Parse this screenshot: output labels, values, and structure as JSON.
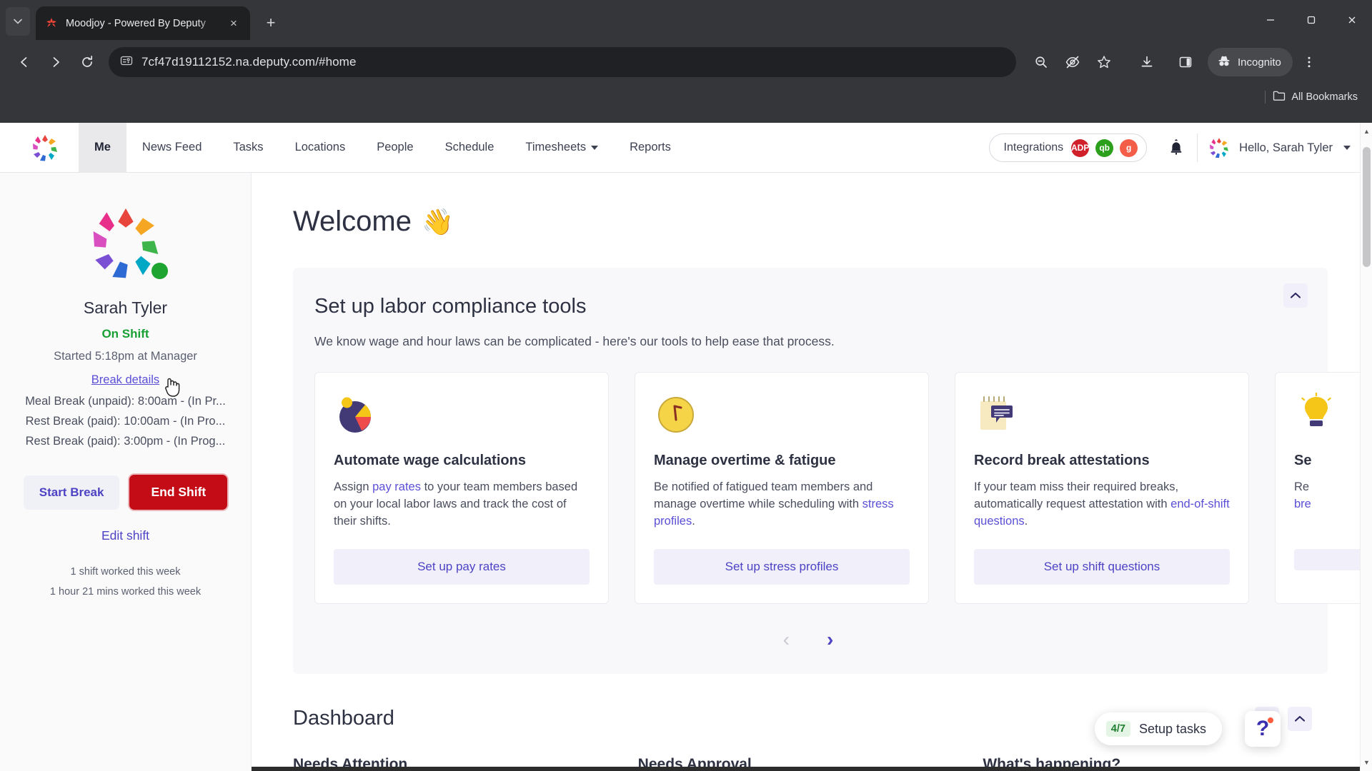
{
  "browser": {
    "tab": {
      "title": "Moodjoy - Powered By Deputy",
      "favicon_name": "moodjoy-favicon"
    },
    "new_tab_label": "+",
    "tab_list_label": "⌄",
    "close_tab_label": "×",
    "window": {
      "minimize": "—",
      "maximize": "❐",
      "close": "✕"
    },
    "toolbar": {
      "back": "←",
      "forward": "→",
      "reload": "⟳",
      "url": "7cf47d19112152.na.deputy.com/#home",
      "site_info_name": "site-info-icon",
      "zoom_out_icon": "zoom-out-icon",
      "hide_icon": "hide-password-icon",
      "bookmark_icon": "star-icon",
      "download_icon": "download-icon",
      "sidepanel_icon": "side-panel-icon",
      "incognito_label": "Incognito",
      "menu_icon": "three-dot-menu-icon"
    },
    "bookmarks": {
      "label": "All Bookmarks"
    }
  },
  "app": {
    "nav": {
      "logo_name": "deputy-logo",
      "items": [
        {
          "label": "Me",
          "active": true,
          "dropdown": false
        },
        {
          "label": "News Feed",
          "active": false,
          "dropdown": false
        },
        {
          "label": "Tasks",
          "active": false,
          "dropdown": false
        },
        {
          "label": "Locations",
          "active": false,
          "dropdown": false
        },
        {
          "label": "People",
          "active": false,
          "dropdown": false
        },
        {
          "label": "Schedule",
          "active": false,
          "dropdown": false
        },
        {
          "label": "Timesheets",
          "active": false,
          "dropdown": true
        },
        {
          "label": "Reports",
          "active": false,
          "dropdown": false
        }
      ],
      "integrations": {
        "label": "Integrations",
        "badges": [
          {
            "name": "adp-badge",
            "text": "ADP",
            "color": "#d0202a"
          },
          {
            "name": "quickbooks-badge",
            "text": "qb",
            "color": "#2ca01c"
          },
          {
            "name": "gusto-badge",
            "text": "g",
            "color": "#f45d48"
          }
        ]
      },
      "notifications_icon": "bell-icon",
      "user": {
        "greeting": "Hello, Sarah Tyler",
        "avatar_name": "user-avatar"
      }
    },
    "sidebar": {
      "avatar_name": "profile-avatar",
      "status_dot_color": "#1ea430",
      "name": "Sarah Tyler",
      "status": "On Shift",
      "started": "Started 5:18pm at Manager",
      "break_details_link": "Break details",
      "breaks": [
        "Meal Break (unpaid): 8:00am - (In Pr...",
        "Rest Break (paid): 10:00am - (In Pro...",
        "Rest Break (paid): 3:00pm - (In Prog..."
      ],
      "start_break_button": "Start Break",
      "end_shift_button": "End Shift",
      "edit_shift_link": "Edit shift",
      "stats": [
        "1 shift worked this week",
        "1 hour 21 mins worked this week"
      ]
    },
    "main": {
      "welcome_title": "Welcome",
      "welcome_emoji": "👋",
      "compliance": {
        "title": "Set up labor compliance tools",
        "subtitle": "We know wage and hour laws can be complicated - here's our tools to help ease that process.",
        "collapse_icon": "chevron-up-icon",
        "cards": [
          {
            "icon_name": "pie-chart-icon",
            "title": "Automate wage calculations",
            "text_before": "Assign ",
            "link": "pay rates",
            "text_after": " to your team members based on your local labor laws and track the cost of their shifts.",
            "button": "Set up pay rates"
          },
          {
            "icon_name": "clock-icon",
            "title": "Manage overtime & fatigue",
            "text_before": "Be notified of fatigued team members and manage overtime while scheduling with ",
            "link": "stress profiles",
            "text_after": ".",
            "button": "Set up stress profiles"
          },
          {
            "icon_name": "notepad-icon",
            "title": "Record break attestations",
            "text_before": "If your team miss their required breaks, automatically request attestation with ",
            "link": "end-of-shift questions",
            "text_after": ".",
            "button": "Set up shift questions"
          },
          {
            "icon_name": "lightbulb-icon",
            "title": "Se",
            "text_before": "Re",
            "link": "bre",
            "text_after": "",
            "button": ""
          }
        ],
        "carousel": {
          "prev": "‹",
          "next": "›"
        }
      },
      "dashboard": {
        "title": "Dashboard",
        "refresh_icon": "refresh-icon",
        "collapse_icon": "chevron-up-icon",
        "columns": [
          {
            "title": "Needs Attention"
          },
          {
            "title": "Needs Approval"
          },
          {
            "title": "What's happening?"
          }
        ]
      },
      "setup_tasks": {
        "count": "4/7",
        "label": "Setup tasks"
      },
      "help": {
        "icon_name": "question-mark-icon",
        "glyph": "?"
      }
    }
  }
}
